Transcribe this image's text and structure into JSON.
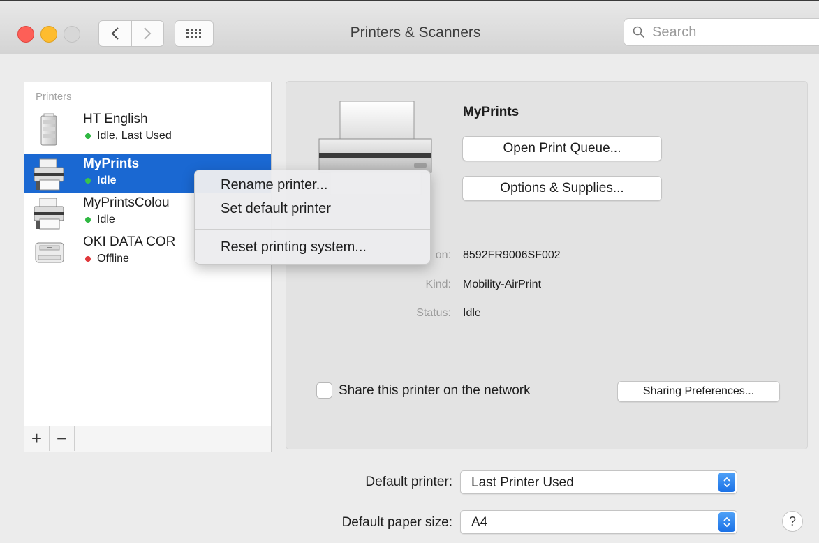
{
  "window": {
    "title": "Printers & Scanners"
  },
  "search": {
    "placeholder": "Search"
  },
  "icons": {
    "back": "chevron-left-icon",
    "forward": "chevron-right-icon",
    "show_all": "grid-icon",
    "search": "magnifier-icon",
    "help": "?"
  },
  "sidebar": {
    "header": "Printers",
    "printers": [
      {
        "name": "HT English",
        "status": "Idle, Last Used",
        "status_color": "#2fb842",
        "selected": false
      },
      {
        "name": "MyPrints",
        "status": "Idle",
        "status_color": "#39c44b",
        "selected": true
      },
      {
        "name": "MyPrintsColou",
        "status": "Idle",
        "status_color": "#2fb842",
        "selected": false
      },
      {
        "name": "OKI DATA COR",
        "status": "Offline",
        "status_color": "#e0383b",
        "selected": false
      }
    ],
    "add_label": "+",
    "remove_label": "−"
  },
  "detail": {
    "title": "MyPrints",
    "open_queue_label": "Open Print Queue...",
    "options_label": "Options & Supplies...",
    "location_label": "on:",
    "location_value": "8592FR9006SF002",
    "kind_label": "Kind:",
    "kind_value": "Mobility-AirPrint",
    "status_label": "Status:",
    "status_value": "Idle",
    "share_label": "Share this printer on the network",
    "share_checked": false,
    "sharing_prefs_label": "Sharing Preferences..."
  },
  "context_menu": {
    "items": [
      {
        "label": "Rename printer..."
      },
      {
        "label": "Set default printer"
      },
      {
        "label": "Reset printing system..."
      }
    ]
  },
  "defaults": {
    "printer_label": "Default printer:",
    "printer_value": "Last Printer Used",
    "paper_label": "Default paper size:",
    "paper_value": "A4"
  },
  "colors": {
    "selection": "#1a68d2",
    "accent": "#1b71e6"
  }
}
